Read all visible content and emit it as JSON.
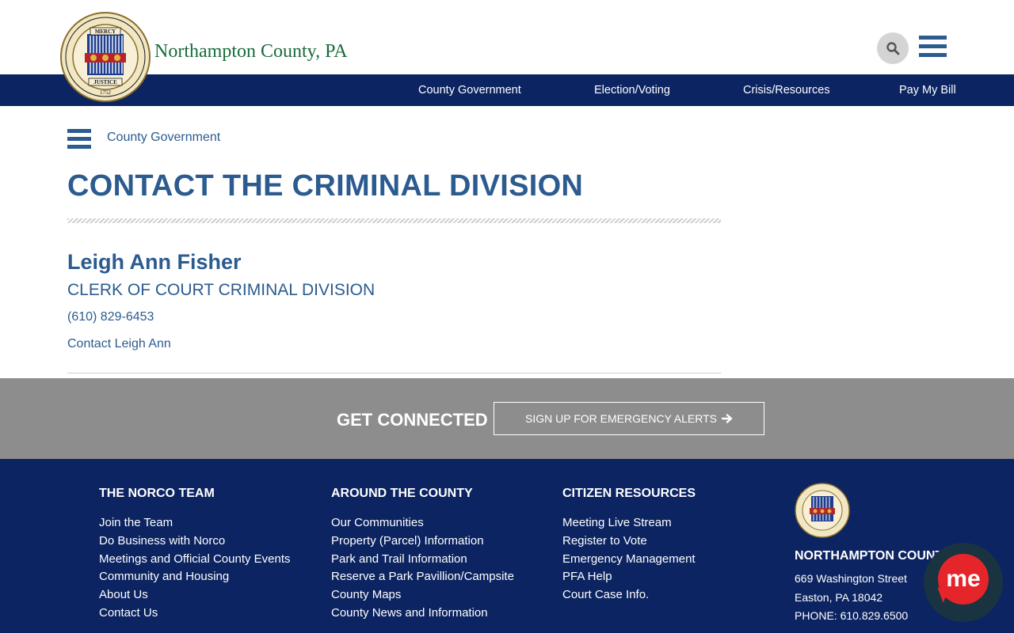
{
  "header": {
    "site_title": "Northampton County, PA",
    "seal_text_top": "MERCY",
    "seal_text_bottom": "JUSTICE",
    "seal_year": "1752",
    "icons": {
      "search": "search-icon",
      "menu": "hamburger-menu-icon"
    }
  },
  "nav": {
    "items": [
      {
        "label": "County Government"
      },
      {
        "label": "Election/Voting"
      },
      {
        "label": "Crisis/Resources"
      },
      {
        "label": "Pay My Bill"
      }
    ]
  },
  "main": {
    "breadcrumb": "County Government",
    "title": "CONTACT THE CRIMINAL DIVISION",
    "contact": {
      "name": "Leigh Ann Fisher",
      "role": "CLERK OF COURT CRIMINAL DIVISION",
      "phone": "(610) 829-6453",
      "link": "Contact Leigh Ann"
    }
  },
  "connect": {
    "title": "GET CONNECTED",
    "button": "SIGN UP FOR EMERGENCY ALERTS"
  },
  "footer": {
    "columns": [
      {
        "title": "THE NORCO TEAM",
        "links": [
          "Join the Team",
          "Do Business with Norco",
          "Meetings and Official County Events",
          "Community and Housing",
          "About Us",
          "Contact Us"
        ]
      },
      {
        "title": "AROUND THE COUNTY",
        "links": [
          "Our Communities",
          "Property (Parcel) Information",
          "Park and Trail Information",
          "Reserve a Park Pavillion/Campsite",
          "County Maps",
          "County News and Information"
        ]
      },
      {
        "title": "CITIZEN RESOURCES",
        "links": [
          "Meeting Live Stream",
          "Register to Vote",
          "Emergency Management",
          "PFA Help",
          "Court Case Info."
        ]
      }
    ],
    "county_name": "NORTHAMPTON COUNTY",
    "address1": "669 Washington Street",
    "address2": "Easton, PA 18042",
    "phone": "PHONE: 610.829.6500"
  },
  "widget": {
    "label": "me"
  },
  "colors": {
    "navy": "#0c2461",
    "blue_text": "#2b5b8f",
    "green_title": "#1a6b3a",
    "grey_band": "#8d8d8d",
    "widget_red": "#e5252a"
  }
}
